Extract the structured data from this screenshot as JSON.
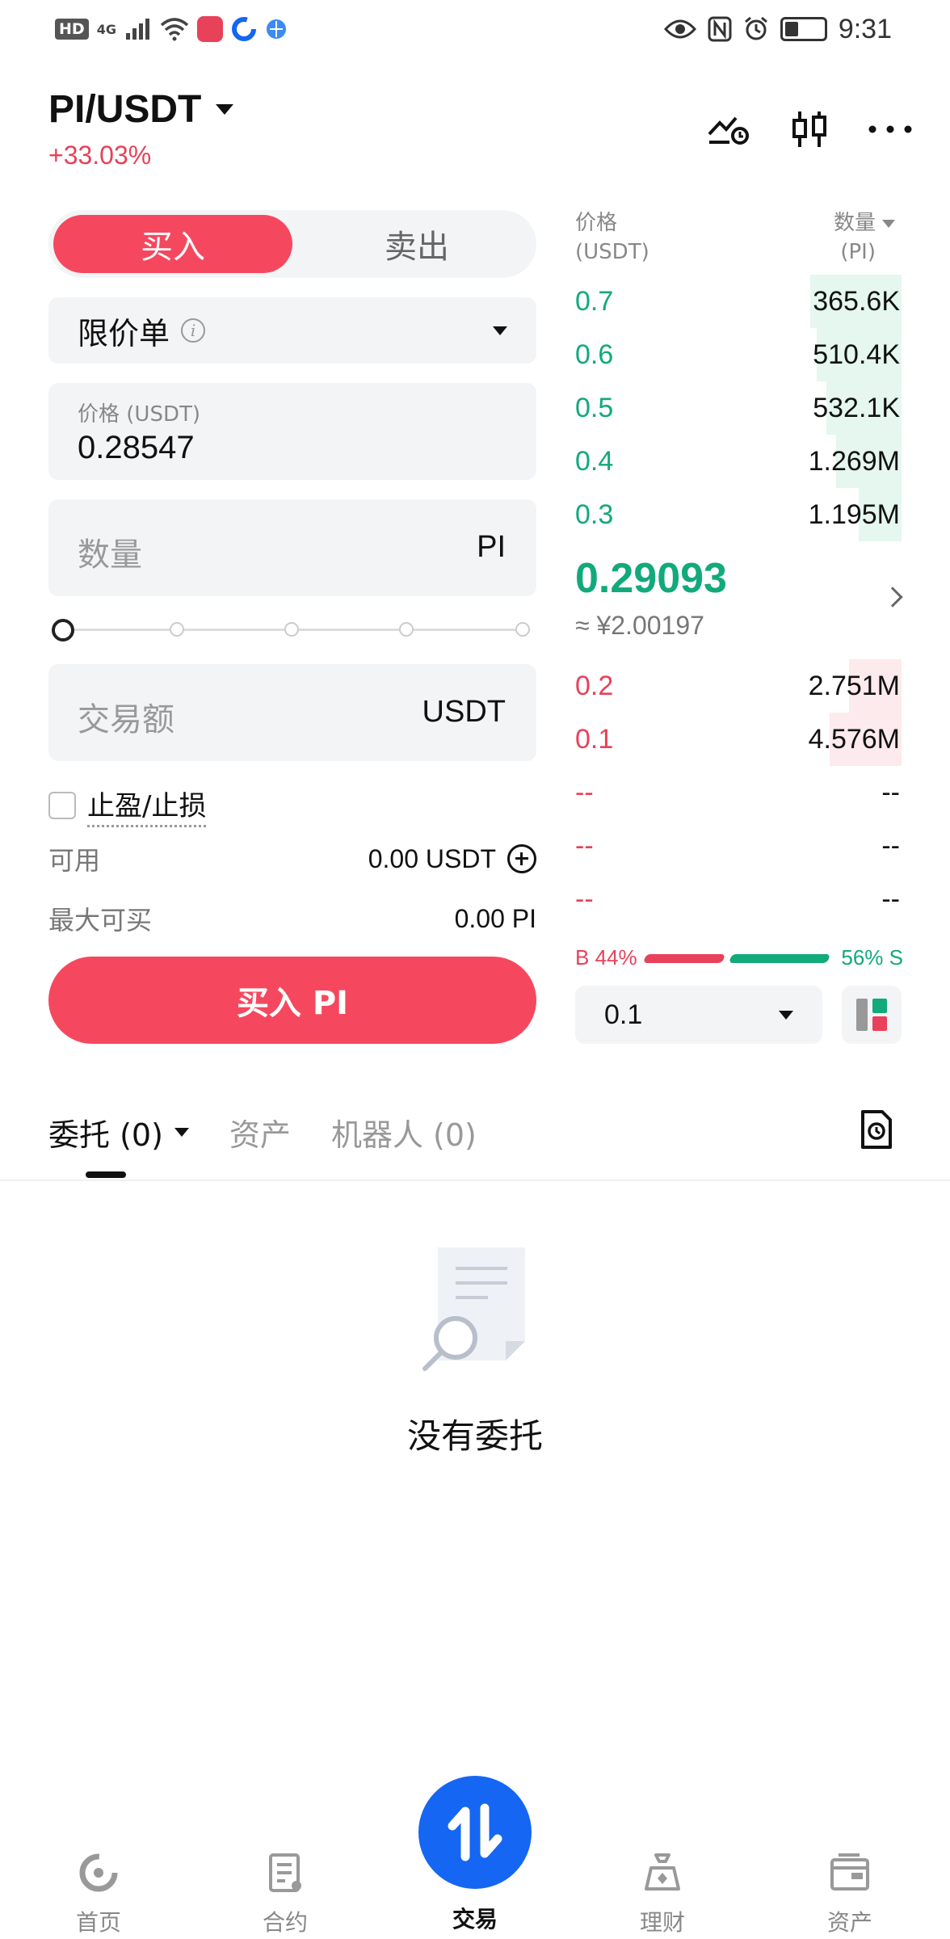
{
  "status_bar": {
    "hd": "HD",
    "network": "4G",
    "time": "9:31"
  },
  "header": {
    "pair": "PI/USDT",
    "change": "+33.03%",
    "icons": [
      "price-alert-icon",
      "candlestick-icon",
      "more-icon"
    ]
  },
  "form": {
    "tabs": {
      "buy": "买入",
      "sell": "卖出"
    },
    "order_type": "限价单",
    "price": {
      "label": "价格 (USDT)",
      "value": "0.28547"
    },
    "amount": {
      "placeholder": "数量",
      "unit": "PI"
    },
    "total": {
      "placeholder": "交易额",
      "unit": "USDT"
    },
    "tpsl_label": "止盈/止损",
    "available": {
      "label": "可用",
      "value": "0.00 USDT"
    },
    "max_buy": {
      "label": "最大可买",
      "value": "0.00 PI"
    },
    "submit": "买入 PI",
    "slider_percent": 0
  },
  "orderbook": {
    "price_header": [
      "价格",
      "(USDT)"
    ],
    "qty_header": [
      "数量",
      "(PI)"
    ],
    "asks": [
      {
        "price": "0.7",
        "qty": "365.6K",
        "depth": 0.28
      },
      {
        "price": "0.6",
        "qty": "510.4K",
        "depth": 0.26
      },
      {
        "price": "0.5",
        "qty": "532.1K",
        "depth": 0.23
      },
      {
        "price": "0.4",
        "qty": "1.269M",
        "depth": 0.2
      },
      {
        "price": "0.3",
        "qty": "1.195M",
        "depth": 0.13
      }
    ],
    "last_price": "0.29093",
    "cny_price": "≈ ¥2.00197",
    "bids": [
      {
        "price": "0.2",
        "qty": "2.751M",
        "depth": 0.16
      },
      {
        "price": "0.1",
        "qty": "4.576M",
        "depth": 0.22
      },
      {
        "price": "--",
        "qty": "--",
        "depth": 0
      },
      {
        "price": "--",
        "qty": "--",
        "depth": 0
      },
      {
        "price": "--",
        "qty": "--",
        "depth": 0
      }
    ],
    "buy_ratio": "B 44%",
    "sell_ratio": "56% S",
    "depth_precision": "0.1"
  },
  "bottom_tabs": {
    "orders": "委托 (0)",
    "assets": "资产",
    "bots": "机器人 (0)"
  },
  "empty_state": "没有委托",
  "nav": {
    "home": "首页",
    "futures": "合约",
    "trade": "交易",
    "earn": "理财",
    "assets": "资产"
  },
  "colors": {
    "buy": "#f5485f",
    "ask_green": "#12a97b",
    "trade_blue": "#1566f2"
  }
}
